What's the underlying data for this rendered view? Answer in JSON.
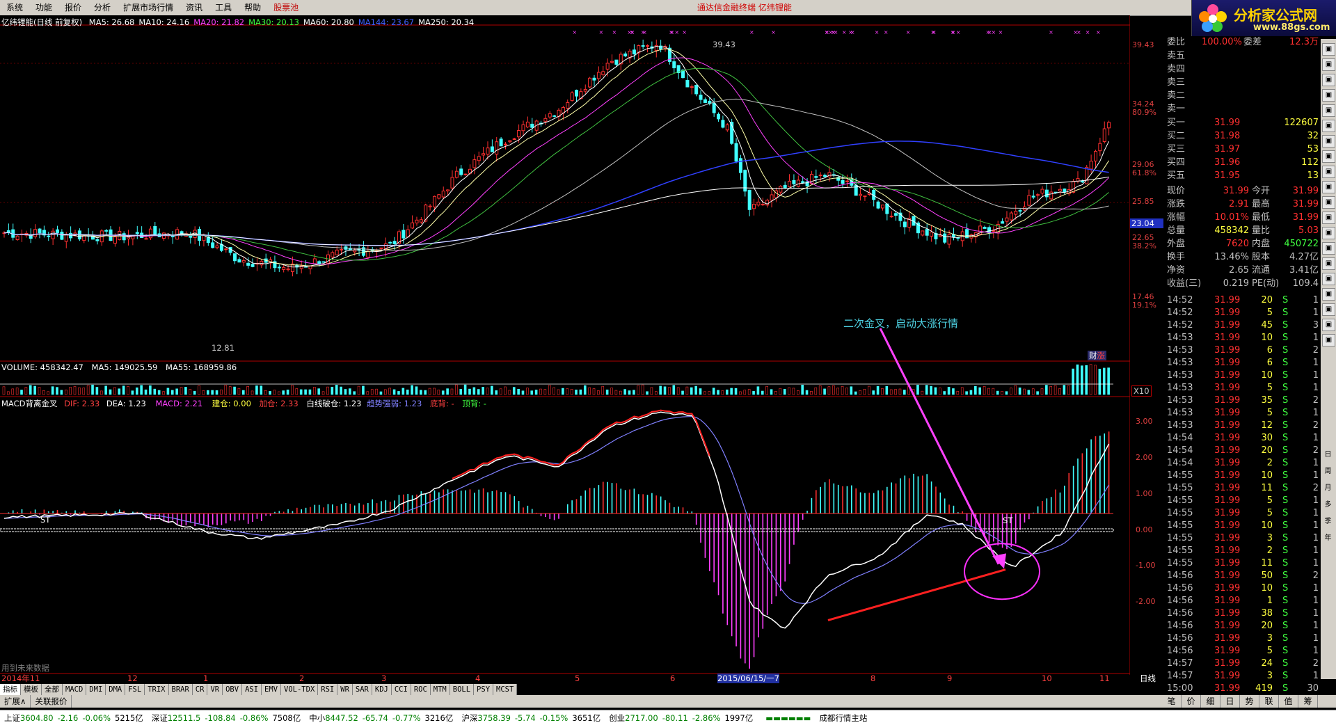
{
  "menu": {
    "items": [
      "系统",
      "功能",
      "报价",
      "分析",
      "扩展市场行情",
      "资讯",
      "工具",
      "帮助"
    ],
    "highlight_item": "股票池",
    "center_text": "通达信金融终端   亿纬锂能"
  },
  "logo": {
    "text": "分析家公式网",
    "url": "www.88gs.com"
  },
  "price_panel": {
    "title": "亿纬锂能(日线 前复权)",
    "mas": [
      {
        "label": "MA5: 26.68",
        "color": "#ffffff"
      },
      {
        "label": "MA10: 24.16",
        "color": "#ffffff"
      },
      {
        "label": "MA20: 21.82",
        "color": "#ff40ff"
      },
      {
        "label": "MA30: 20.13",
        "color": "#40ff40"
      },
      {
        "label": "MA60: 20.80",
        "color": "#ffffff"
      },
      {
        "label": "MA144: 23.67",
        "color": "#4060ff"
      },
      {
        "label": "MA250: 20.34",
        "color": "#ffffff"
      }
    ],
    "high_label": "39.43",
    "low_label": "12.81",
    "price_ticks": [
      {
        "v": "39.43"
      },
      {
        "v": "34.24"
      },
      {
        "v": "80.9%"
      },
      {
        "v": "29.06"
      },
      {
        "v": "61.8%"
      },
      {
        "v": "25.85"
      },
      {
        "v": "22.65"
      },
      {
        "v": "38.2%"
      },
      {
        "v": "17.46"
      },
      {
        "v": "19.1%"
      }
    ],
    "current_tag": "23.04",
    "annotation": "二次金叉，启动大涨行情",
    "badge": "财",
    "badge2": "涨"
  },
  "volume_panel": {
    "title": "VOLUME: 458342.47",
    "ma5": "MA5: 149025.59",
    "ma55": "MA55: 168959.86",
    "unit": "X10"
  },
  "macd_panel": {
    "title": "MACD背离金叉",
    "dif": "DIF: 2.33",
    "dea": "DEA: 1.23",
    "macd": "MACD: 2.21",
    "jc": "建仓: 0.00",
    "jia": "加仓: 2.33",
    "bxjc": "白线破仓: 1.23",
    "trend": "趋势强弱: 1.23",
    "bottom": "底背: -",
    "top": "顶背: -",
    "ticks": [
      "3.00",
      "2.00",
      "1.00",
      "0.00",
      "-1.00",
      "-2.00"
    ],
    "st_label": "ST",
    "future_note": "用到未来数据"
  },
  "x_axis": {
    "labels": [
      "2014年11",
      "12",
      "1",
      "2",
      "3",
      "4",
      "5",
      "6",
      "2015/06/15/一7",
      "8",
      "9",
      "10",
      "11"
    ],
    "period": "日线"
  },
  "tabs": [
    "指标",
    "模板",
    "全部",
    "MACD",
    "DMI",
    "DMA",
    "FSL",
    "TRIX",
    "BRAR",
    "CR",
    "VR",
    "OBV",
    "ASI",
    "EMV",
    "VOL-TDX",
    "RSI",
    "WR",
    "SAR",
    "KDJ",
    "CCI",
    "ROC",
    "MTM",
    "BOLL",
    "PSY",
    "MCST"
  ],
  "ext_tabs": [
    "扩展∧",
    "关联报价"
  ],
  "right_tabs": [
    "笔",
    "价",
    "细",
    "日",
    "势",
    "联",
    "值",
    "筹"
  ],
  "quote": {
    "wb_label": "委比",
    "wb": "100.00%",
    "wc_label": "委差",
    "wc": "12.3万",
    "sell": [
      {
        "l": "卖五"
      },
      {
        "l": "卖四"
      },
      {
        "l": "卖三"
      },
      {
        "l": "卖二"
      },
      {
        "l": "卖一"
      }
    ],
    "buy": [
      {
        "l": "买一",
        "p": "31.99",
        "v": "122607"
      },
      {
        "l": "买二",
        "p": "31.98",
        "v": "32"
      },
      {
        "l": "买三",
        "p": "31.97",
        "v": "53"
      },
      {
        "l": "买四",
        "p": "31.96",
        "v": "112"
      },
      {
        "l": "买五",
        "p": "31.95",
        "v": "13"
      }
    ],
    "stats": [
      {
        "a": "现价",
        "b": "31.99",
        "c": "今开",
        "d": "31.99"
      },
      {
        "a": "涨跌",
        "b": "2.91",
        "c": "最高",
        "d": "31.99"
      },
      {
        "a": "涨幅",
        "b": "10.01%",
        "c": "最低",
        "d": "31.99"
      },
      {
        "a": "总量",
        "b": "458342",
        "c": "量比",
        "d": "5.03"
      },
      {
        "a": "外盘",
        "b": "7620",
        "c": "内盘",
        "d": "450722"
      },
      {
        "a": "换手",
        "b": "13.46%",
        "c": "股本",
        "d": "4.27亿"
      },
      {
        "a": "净资",
        "b": "2.65",
        "c": "流通",
        "d": "3.41亿"
      },
      {
        "a": "收益(三)",
        "b": "0.219",
        "c": "PE(动)",
        "d": "109.4"
      }
    ],
    "ticks": [
      {
        "t": "14:52",
        "p": "31.99",
        "v": "20",
        "s": "S",
        "n": "1"
      },
      {
        "t": "14:52",
        "p": "31.99",
        "v": "5",
        "s": "S",
        "n": "1"
      },
      {
        "t": "14:52",
        "p": "31.99",
        "v": "45",
        "s": "S",
        "n": "3"
      },
      {
        "t": "14:53",
        "p": "31.99",
        "v": "10",
        "s": "S",
        "n": "1"
      },
      {
        "t": "14:53",
        "p": "31.99",
        "v": "6",
        "s": "S",
        "n": "2"
      },
      {
        "t": "14:53",
        "p": "31.99",
        "v": "6",
        "s": "S",
        "n": "1"
      },
      {
        "t": "14:53",
        "p": "31.99",
        "v": "10",
        "s": "S",
        "n": "1"
      },
      {
        "t": "14:53",
        "p": "31.99",
        "v": "5",
        "s": "S",
        "n": "1"
      },
      {
        "t": "14:53",
        "p": "31.99",
        "v": "35",
        "s": "S",
        "n": "2"
      },
      {
        "t": "14:53",
        "p": "31.99",
        "v": "5",
        "s": "S",
        "n": "1"
      },
      {
        "t": "14:53",
        "p": "31.99",
        "v": "12",
        "s": "S",
        "n": "2"
      },
      {
        "t": "14:54",
        "p": "31.99",
        "v": "30",
        "s": "S",
        "n": "1"
      },
      {
        "t": "14:54",
        "p": "31.99",
        "v": "20",
        "s": "S",
        "n": "2"
      },
      {
        "t": "14:54",
        "p": "31.99",
        "v": "2",
        "s": "S",
        "n": "1"
      },
      {
        "t": "14:55",
        "p": "31.99",
        "v": "10",
        "s": "S",
        "n": "1"
      },
      {
        "t": "14:55",
        "p": "31.99",
        "v": "11",
        "s": "S",
        "n": "2"
      },
      {
        "t": "14:55",
        "p": "31.99",
        "v": "5",
        "s": "S",
        "n": "1"
      },
      {
        "t": "14:55",
        "p": "31.99",
        "v": "5",
        "s": "S",
        "n": "1"
      },
      {
        "t": "14:55",
        "p": "31.99",
        "v": "10",
        "s": "S",
        "n": "1"
      },
      {
        "t": "14:55",
        "p": "31.99",
        "v": "3",
        "s": "S",
        "n": "1"
      },
      {
        "t": "14:55",
        "p": "31.99",
        "v": "2",
        "s": "S",
        "n": "1"
      },
      {
        "t": "14:55",
        "p": "31.99",
        "v": "11",
        "s": "S",
        "n": "1"
      },
      {
        "t": "14:56",
        "p": "31.99",
        "v": "50",
        "s": "S",
        "n": "2"
      },
      {
        "t": "14:56",
        "p": "31.99",
        "v": "10",
        "s": "S",
        "n": "1"
      },
      {
        "t": "14:56",
        "p": "31.99",
        "v": "1",
        "s": "S",
        "n": "1"
      },
      {
        "t": "14:56",
        "p": "31.99",
        "v": "38",
        "s": "S",
        "n": "1"
      },
      {
        "t": "14:56",
        "p": "31.99",
        "v": "20",
        "s": "S",
        "n": "1"
      },
      {
        "t": "14:56",
        "p": "31.99",
        "v": "3",
        "s": "S",
        "n": "1"
      },
      {
        "t": "14:56",
        "p": "31.99",
        "v": "5",
        "s": "S",
        "n": "1"
      },
      {
        "t": "14:57",
        "p": "31.99",
        "v": "24",
        "s": "S",
        "n": "2"
      },
      {
        "t": "14:57",
        "p": "31.99",
        "v": "3",
        "s": "S",
        "n": "1"
      },
      {
        "t": "15:00",
        "p": "31.99",
        "v": "419",
        "s": "S",
        "n": "30"
      }
    ]
  },
  "side_tools": [
    "日",
    "周",
    "月",
    "多",
    "季",
    "年"
  ],
  "status_bar": [
    {
      "name": "上证",
      "val": "3604.80",
      "chg": "-2.16",
      "pct": "-0.06%",
      "amt": "5215亿"
    },
    {
      "name": "深证",
      "val": "12511.5",
      "chg": "-108.84",
      "pct": "-0.86%",
      "amt": "7508亿"
    },
    {
      "name": "中小",
      "val": "8447.52",
      "chg": "-65.74",
      "pct": "-0.77%",
      "amt": "3216亿"
    },
    {
      "name": "沪深",
      "val": "3758.39",
      "chg": "-5.74",
      "pct": "-0.15%",
      "amt": "3651亿"
    },
    {
      "name": "创业",
      "val": "2717.00",
      "chg": "-80.11",
      "pct": "-2.86%",
      "amt": "1997亿"
    }
  ],
  "status_right": "成都行情主站",
  "colors": {
    "up": "#ff3030",
    "down": "#40ffff",
    "dif": "#ffffff",
    "dea": "#8080ff",
    "accent": "#ff00ff"
  }
}
